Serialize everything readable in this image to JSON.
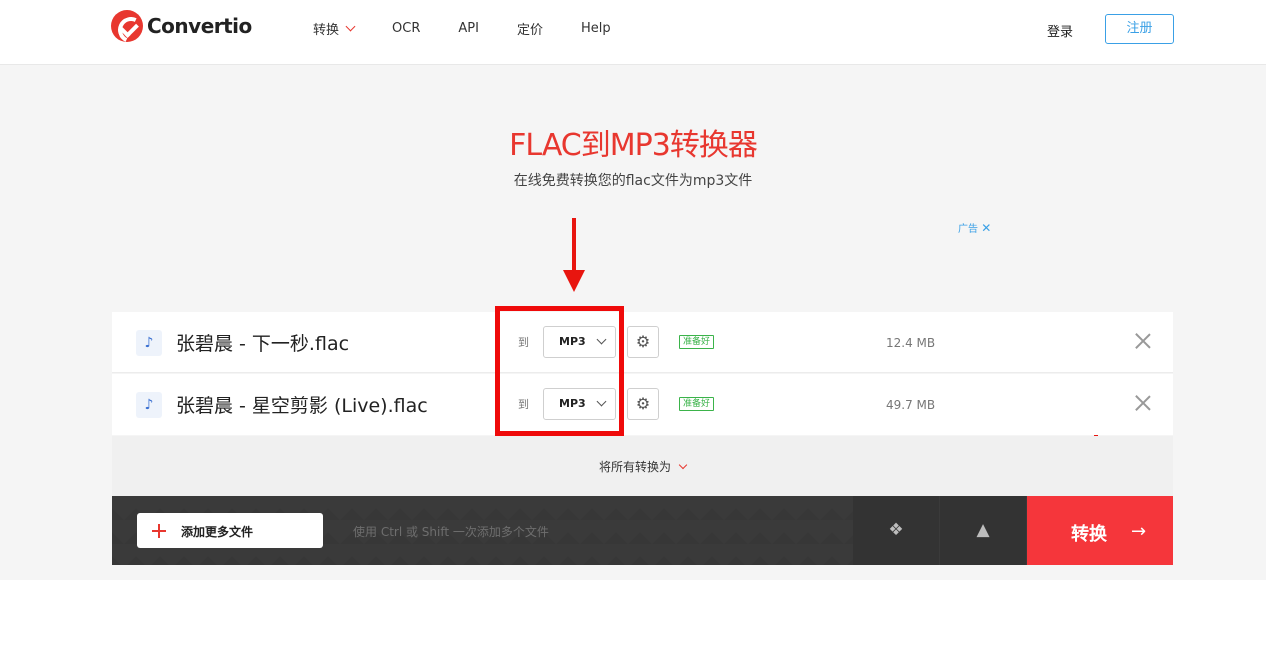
{
  "header": {
    "brand": "Convertio",
    "nav": [
      "转换",
      "OCR",
      "API",
      "定价",
      "Help"
    ],
    "login": "登录",
    "register": "注册"
  },
  "hero": {
    "title": "FLAC到MP3转换器",
    "subtitle": "在线免费转换您的flac文件为mp3文件",
    "ad_label": "广告",
    "ad_close": "✕"
  },
  "files": [
    {
      "name": "张碧晨 - 下一秒.flac",
      "to_label": "到",
      "format": "MP3",
      "status": "准备好",
      "size": "12.4 MB"
    },
    {
      "name": "张碧晨 - 星空剪影 (Live).flac",
      "to_label": "到",
      "format": "MP3",
      "status": "准备好",
      "size": "49.7 MB"
    }
  ],
  "convert_all": "将所有转换为",
  "bottom_bar": {
    "add_files": "添加更多文件",
    "hint": "使用 Ctrl 或 Shift 一次添加多个文件",
    "convert": "转换"
  },
  "icons": {
    "file": "music-note-icon",
    "settings": "gear-icon",
    "dropbox": "dropbox-icon",
    "google_drive": "google-drive-icon"
  },
  "colors": {
    "accent": "#e8372f",
    "link": "#3aa0e6",
    "ready": "#3bb34a",
    "convert_button": "#f5363b",
    "annotation": "#ef0a0a"
  }
}
